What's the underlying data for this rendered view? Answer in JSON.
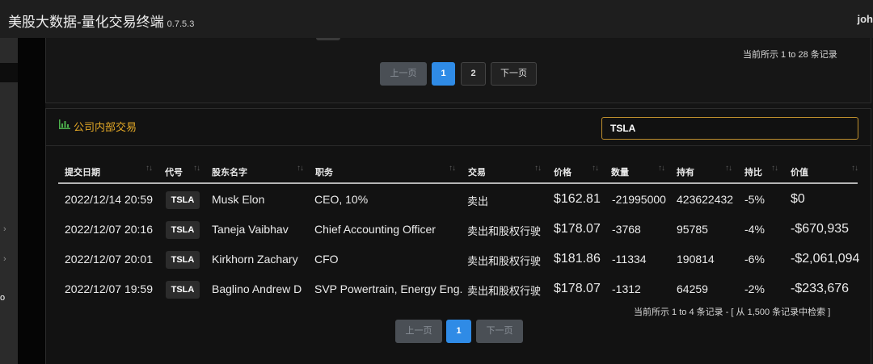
{
  "app": {
    "title": "美股大数据-量化交易终端",
    "version": "0.7.5.3",
    "user": "joh"
  },
  "sidebar": {
    "arrow1": "›",
    "arrow2": "›",
    "dot": "o"
  },
  "top_panel": {
    "record_info": "当前所示 1 to 28 条记录",
    "pagination": {
      "prev": "上一页",
      "pages": [
        "1",
        "2"
      ],
      "next": "下一页"
    }
  },
  "insider": {
    "title": "公司内部交易",
    "search_value": "TSLA",
    "columns": [
      "提交日期",
      "代号",
      "股东名字",
      "职务",
      "交易",
      "价格",
      "数量",
      "持有",
      "持比",
      "价值"
    ],
    "sort_glyph": "↑↓",
    "rows": [
      {
        "date": "2022/12/14 20:59",
        "ticker": "TSLA",
        "name": "Musk Elon",
        "title": "CEO, 10%",
        "trade": "卖出",
        "price": "$162.81",
        "qty": "-21995000",
        "owned": "423622432",
        "pct": "-5%",
        "value": "$0"
      },
      {
        "date": "2022/12/07 20:16",
        "ticker": "TSLA",
        "name": "Taneja Vaibhav",
        "title": "Chief Accounting Officer",
        "trade": "卖出和股权行驶",
        "price": "$178.07",
        "qty": "-3768",
        "owned": "95785",
        "pct": "-4%",
        "value": "-$670,935"
      },
      {
        "date": "2022/12/07 20:01",
        "ticker": "TSLA",
        "name": "Kirkhorn Zachary",
        "title": "CFO",
        "trade": "卖出和股权行驶",
        "price": "$181.86",
        "qty": "-11334",
        "owned": "190814",
        "pct": "-6%",
        "value": "-$2,061,094"
      },
      {
        "date": "2022/12/07 19:59",
        "ticker": "TSLA",
        "name": "Baglino Andrew D",
        "title": "SVP Powertrain, Energy Eng.",
        "trade": "卖出和股权行驶",
        "price": "$178.07",
        "qty": "-1312",
        "owned": "64259",
        "pct": "-2%",
        "value": "-$233,676"
      }
    ],
    "record_info": "当前所示 1 to 4 条记录 - [ 从 1,500 条记录中检索 ]",
    "pagination": {
      "prev": "上一页",
      "pages": [
        "1"
      ],
      "next": "下一页"
    }
  },
  "colors": {
    "accent_title": "#e3a826",
    "chart_icon": "#4cae4c",
    "active_page": "#2f8be6",
    "search_border": "#bf8f2e"
  }
}
